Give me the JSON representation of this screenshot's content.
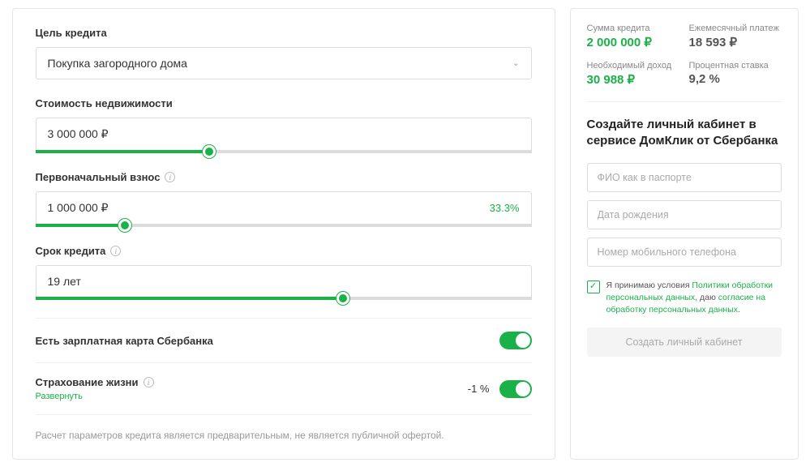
{
  "left": {
    "purpose": {
      "label": "Цель кредита",
      "value": "Покупка загородного дома"
    },
    "property": {
      "label": "Стоимость недвижимости",
      "value": "3 000 000 ₽",
      "fill_pct": 35
    },
    "down": {
      "label": "Первоначальный взнос",
      "value": "1 000 000 ₽",
      "badge": "33.3%",
      "fill_pct": 18
    },
    "term": {
      "label": "Срок кредита",
      "value": "19 лет",
      "fill_pct": 62
    },
    "salary_card": {
      "label": "Есть зарплатная карта Сбербанка"
    },
    "insurance": {
      "label": "Страхование жизни",
      "expand": "Развернуть",
      "discount": "-1 %"
    },
    "disclaimer": "Расчет параметров кредита является предварительным, не является публичной офертой."
  },
  "right": {
    "summary": {
      "amount": {
        "label": "Сумма кредита",
        "value": "2 000 000 ₽"
      },
      "payment": {
        "label": "Ежемесячный платеж",
        "value": "18 593 ₽"
      },
      "income": {
        "label": "Необходимый доход",
        "value": "30 988 ₽"
      },
      "rate": {
        "label": "Процентная ставка",
        "value": "9,2 %"
      }
    },
    "signup": {
      "title": "Создайте личный кабинет в сервисе ДомКлик от Сбербанка",
      "name_ph": "ФИО как в паспорте",
      "dob_ph": "Дата рождения",
      "phone_ph": "Номер мобильного телефона",
      "consent_pre": "Я принимаю условия ",
      "consent_link1": "Политики обработки персональных данных",
      "consent_mid": ", даю ",
      "consent_link2": "согласие на обработку персональных данных",
      "consent_post": ".",
      "button": "Создать личный кабинет"
    }
  }
}
